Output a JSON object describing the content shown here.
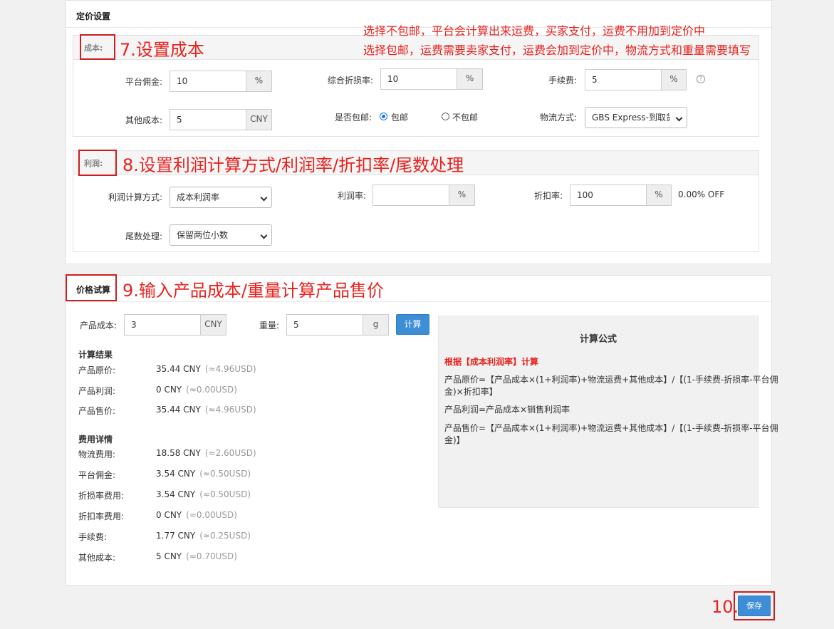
{
  "pricing": {
    "title": "定价设置",
    "cost": {
      "label": "成本:",
      "platform_fee_label": "平台佣金:",
      "platform_fee_value": "10",
      "platform_fee_unit": "%",
      "loss_rate_label": "综合折损率:",
      "loss_rate_value": "10",
      "loss_rate_unit": "%",
      "handling_fee_label": "手续费:",
      "handling_fee_value": "5",
      "handling_fee_unit": "%",
      "other_cost_label": "其他成本:",
      "other_cost_value": "5",
      "other_cost_unit": "CNY",
      "free_shipping_label": "是否包邮:",
      "free_shipping_yes": "包邮",
      "free_shipping_no": "不包邮",
      "logistics_label": "物流方式:",
      "logistics_value": "GBS Express-到取货"
    },
    "profit": {
      "label": "利润:",
      "calc_method_label": "利润计算方式:",
      "calc_method_value": "成本利润率",
      "profit_rate_label": "利润率:",
      "profit_rate_value": "",
      "profit_rate_unit": "%",
      "discount_label": "折扣率:",
      "discount_value": "100",
      "discount_unit": "%",
      "discount_off": "0.00% OFF",
      "rounding_label": "尾数处理:",
      "rounding_value": "保留两位小数"
    }
  },
  "trial": {
    "title": "价格试算",
    "product_cost_label": "产品成本:",
    "product_cost_value": "3",
    "product_cost_unit": "CNY",
    "weight_label": "重量:",
    "weight_value": "5",
    "weight_unit": "g",
    "calc_button": "计算",
    "results_title": "计算结果",
    "results": [
      {
        "label": "产品原价:",
        "value": "35.44 CNY",
        "usd": "(≈4.96USD)"
      },
      {
        "label": "产品利润:",
        "value": "0 CNY",
        "usd": "(≈0.00USD)"
      },
      {
        "label": "产品售价:",
        "value": "35.44 CNY",
        "usd": "(≈4.96USD)"
      }
    ],
    "fees_title": "费用详情",
    "fees": [
      {
        "label": "物流费用:",
        "value": "18.58 CNY",
        "usd": "(≈2.60USD)"
      },
      {
        "label": "平台佣金:",
        "value": "3.54 CNY",
        "usd": "(≈0.50USD)"
      },
      {
        "label": "折损率费用:",
        "value": "3.54 CNY",
        "usd": "(≈0.50USD)"
      },
      {
        "label": "折扣率费用:",
        "value": "0 CNY",
        "usd": "(≈0.00USD)"
      },
      {
        "label": "手续费:",
        "value": "1.77 CNY",
        "usd": "(≈0.25USD)"
      },
      {
        "label": "其他成本:",
        "value": "5 CNY",
        "usd": "(≈0.70USD)"
      }
    ],
    "formula": {
      "title": "计算公式",
      "basis": "根据【成本利润率】计算",
      "line1a": "产品原价=【产品成本×(1+利润率)+物流运费+其他成本】/【(1-手续费-折损率-平台佣",
      "line1b": "金)×折扣率】",
      "line2": "产品利润=产品成本×销售利润率",
      "line3a": "产品售价=【产品成本×(1+利润率)+物流运费+其他成本】/【(1-手续费-折损率-平台佣",
      "line3b": "金)】"
    }
  },
  "save_button": "保存",
  "annotations": {
    "step7": "7.设置成本",
    "step8": "8.设置利润计算方式/利润率/折扣率/尾数处理",
    "step9": "9.输入产品成本/重量计算产品售价",
    "step10": "10.",
    "note1": "选择不包邮，平台会计算出来运费，买家支付，运费不用加到定价中",
    "note2": "选择包邮，运费需要卖家支付，运费会加到定价中，物流方式和重量需要填写"
  }
}
